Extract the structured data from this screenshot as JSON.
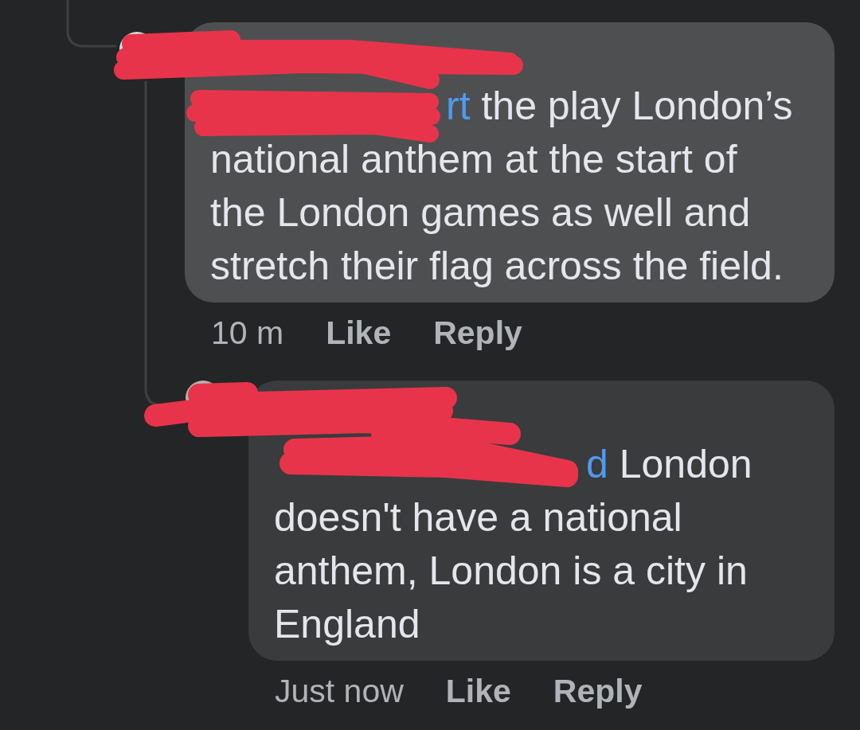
{
  "comments": [
    {
      "redacted": true,
      "highlighted": true,
      "mention": "rt",
      "text": "the play London’s national anthem at the start of the London games as well and stretch their flag across the field.",
      "time": "10 m",
      "like": "Like",
      "reply": "Reply"
    },
    {
      "redacted": true,
      "highlighted": false,
      "mention": "d",
      "text": "London doesn't have a national anthem, London is a city in England",
      "time": "Just now",
      "like": "Like",
      "reply": "Reply"
    }
  ]
}
